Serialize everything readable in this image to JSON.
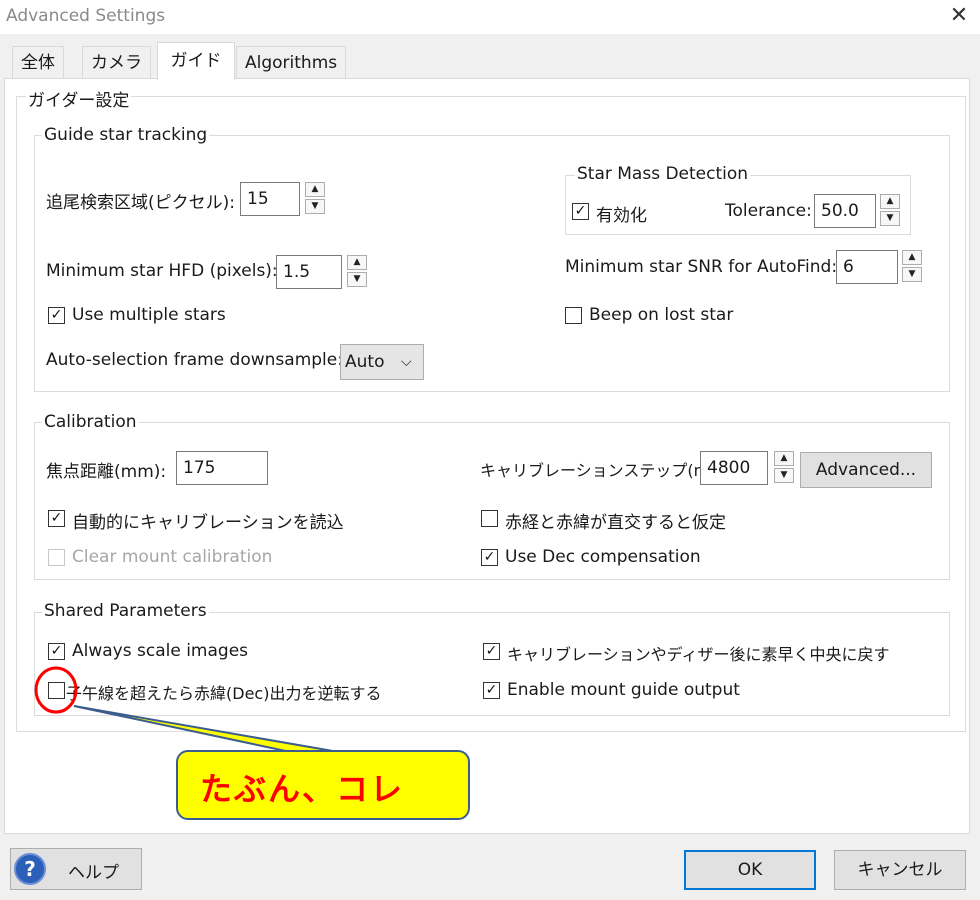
{
  "window": {
    "title": "Advanced Settings",
    "close_glyph": "✕"
  },
  "tabs": [
    {
      "label": "全体"
    },
    {
      "label": "カメラ"
    },
    {
      "label": "ガイド"
    },
    {
      "label": "Algorithms"
    }
  ],
  "guider_settings": {
    "title": "ガイダー設定"
  },
  "guide_star_tracking": {
    "title": "Guide star tracking",
    "search_region": {
      "label": "追尾検索区域(ピクセル):",
      "value": "15"
    },
    "min_hfd": {
      "label": "Minimum star HFD (pixels):",
      "value": "1.5"
    },
    "use_multiple_stars": {
      "label": "Use multiple stars",
      "checked": true
    },
    "downsample": {
      "label": "Auto-selection frame downsample:",
      "value": "Auto"
    },
    "star_mass": {
      "title": "Star Mass Detection",
      "enabled": {
        "label": "有効化",
        "checked": true
      },
      "tolerance": {
        "label": "Tolerance:",
        "value": "50.0"
      }
    },
    "min_snr": {
      "label": "Minimum star SNR for AutoFind:",
      "value": "6"
    },
    "beep": {
      "label": "Beep on lost star",
      "checked": false
    }
  },
  "calibration": {
    "title": "Calibration",
    "focal_length": {
      "label": "焦点距離(mm):",
      "value": "175"
    },
    "cal_step": {
      "label": "キャリブレーションステップ(ms):",
      "value": "4800"
    },
    "advanced_button": "Advanced...",
    "auto_load": {
      "label": "自動的にキャリブレーションを読込",
      "checked": true
    },
    "assume_orthogonal": {
      "label": "赤経と赤緯が直交すると仮定",
      "checked": false
    },
    "clear_mount": {
      "label": "Clear mount calibration",
      "checked": false,
      "disabled": true
    },
    "dec_comp": {
      "label": "Use Dec compensation",
      "checked": true
    }
  },
  "shared": {
    "title": "Shared Parameters",
    "always_scale": {
      "label": "Always scale images",
      "checked": true
    },
    "recenter": {
      "label": "キャリブレーションやディザー後に素早く中央に戻す",
      "checked": true
    },
    "reverse_dec": {
      "label": "子午線を超えたら赤緯(Dec)出力を逆転する",
      "checked": false
    },
    "enable_mount": {
      "label": "Enable mount guide output",
      "checked": true
    }
  },
  "annotation": {
    "text": "たぶん、コレ",
    "highlight_color": "#ff0000",
    "fill_color": "#ffff00"
  },
  "footer": {
    "help": "ヘルプ",
    "ok": "OK",
    "cancel": "キャンセル"
  },
  "glyphs": {
    "check": "✓",
    "up": "▲",
    "down": "▼",
    "dropdown": "⌵",
    "help": "?"
  }
}
